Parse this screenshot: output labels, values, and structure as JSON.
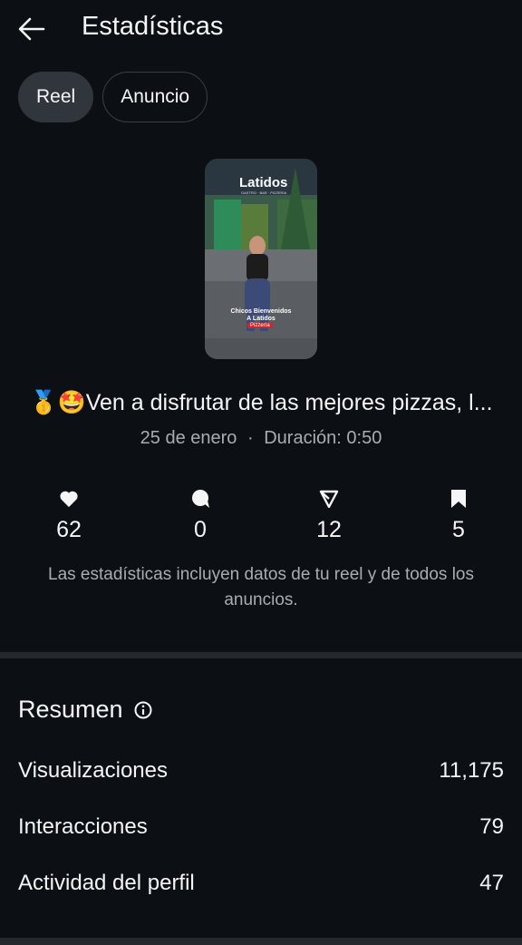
{
  "header": {
    "title": "Estadísticas",
    "back_icon": "arrow-left-icon"
  },
  "tabs": [
    {
      "label": "Reel",
      "active": true
    },
    {
      "label": "Anuncio",
      "active": false
    }
  ],
  "thumbnail": {
    "brand_text": "Latidos",
    "brand_subtext": "GASTRO · BAR · PIZZERIA",
    "overlay_line1": "Chicos Bienvenidos",
    "overlay_line2": "A Latidos",
    "overlay_tag": "Pizzería"
  },
  "post": {
    "caption": "🥇🤩Ven a disfrutar de las mejores pizzas, l...",
    "date": "25 de enero",
    "separator": "·",
    "duration": "Duración: 0:50"
  },
  "stats": {
    "likes": "62",
    "comments": "0",
    "shares": "12",
    "saves": "5",
    "note": "Las estadísticas incluyen datos de tu reel y de todos los anuncios."
  },
  "summary": {
    "title": "Resumen",
    "rows": [
      {
        "label": "Visualizaciones",
        "value": "11,175"
      },
      {
        "label": "Interacciones",
        "value": "79"
      },
      {
        "label": "Actividad del perfil",
        "value": "47"
      }
    ]
  },
  "colors": {
    "background": "#0c1014",
    "divider": "#25292e",
    "muted_text": "#a8adb3",
    "chip_active": "#31363d"
  }
}
